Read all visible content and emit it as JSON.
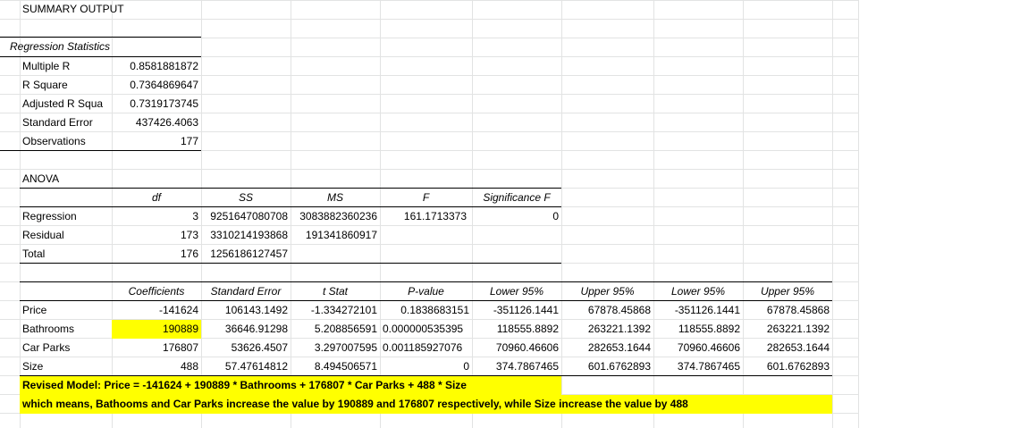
{
  "sheet": {
    "title": "SUMMARY OUTPUT",
    "regression_statistics": {
      "header": "Regression Statistics",
      "rows": [
        {
          "label": "Multiple R",
          "value": "0.8581881872"
        },
        {
          "label": "R Square",
          "value": "0.7364869647"
        },
        {
          "label": "Adjusted R Squa",
          "value": "0.7319173745"
        },
        {
          "label": "Standard Error",
          "value": "437426.4063"
        },
        {
          "label": "Observations",
          "value": "177"
        }
      ]
    },
    "anova": {
      "title": "ANOVA",
      "headers": [
        "",
        "df",
        "SS",
        "MS",
        "F",
        "Significance F"
      ],
      "rows": [
        [
          "Regression",
          "3",
          "9251647080708",
          "3083882360236",
          "161.1713373",
          "0"
        ],
        [
          "Residual",
          "173",
          "3310214193868",
          "191341860917",
          "",
          ""
        ],
        [
          "Total",
          "176",
          "1256186127457",
          "",
          "",
          ""
        ]
      ]
    },
    "coefficients": {
      "headers": [
        "",
        "Coefficients",
        "Standard Error",
        "t Stat",
        "P-value",
        "Lower 95%",
        "Upper 95%",
        "Lower 95%",
        "Upper 95%"
      ],
      "rows": [
        [
          "Price",
          "-141624",
          "106143.1492",
          "-1.334272101",
          "0.1838683151",
          "-351126.1441",
          "67878.45868",
          "-351126.1441",
          "67878.45868"
        ],
        [
          "Bathrooms",
          "190889",
          "36646.91298",
          "5.208856591",
          "0.000000535395",
          "118555.8892",
          "263221.1392",
          "118555.8892",
          "263221.1392"
        ],
        [
          "Car Parks",
          "176807",
          "53626.4507",
          "3.297007595",
          "0.001185927076",
          "70960.46606",
          "282653.1644",
          "70960.46606",
          "282653.1644"
        ],
        [
          "Size",
          "488",
          "57.47614812",
          "8.494506571",
          "0",
          "374.7867465",
          "601.6762893",
          "374.7867465",
          "601.6762893"
        ]
      ]
    },
    "notes": {
      "revised_model": "Revised Model: Price = -141624 + 190889 * Bathrooms + 176807 * Car Parks + 488 * Size",
      "interpretation": "which means, Bathooms and Car Parks increase the value by 190889 and 176807 respectively, while Size increase the value by 488"
    },
    "colors": {
      "highlight": "#ffff00",
      "gridline": "#e2e3e3",
      "rule": "#000000"
    }
  }
}
